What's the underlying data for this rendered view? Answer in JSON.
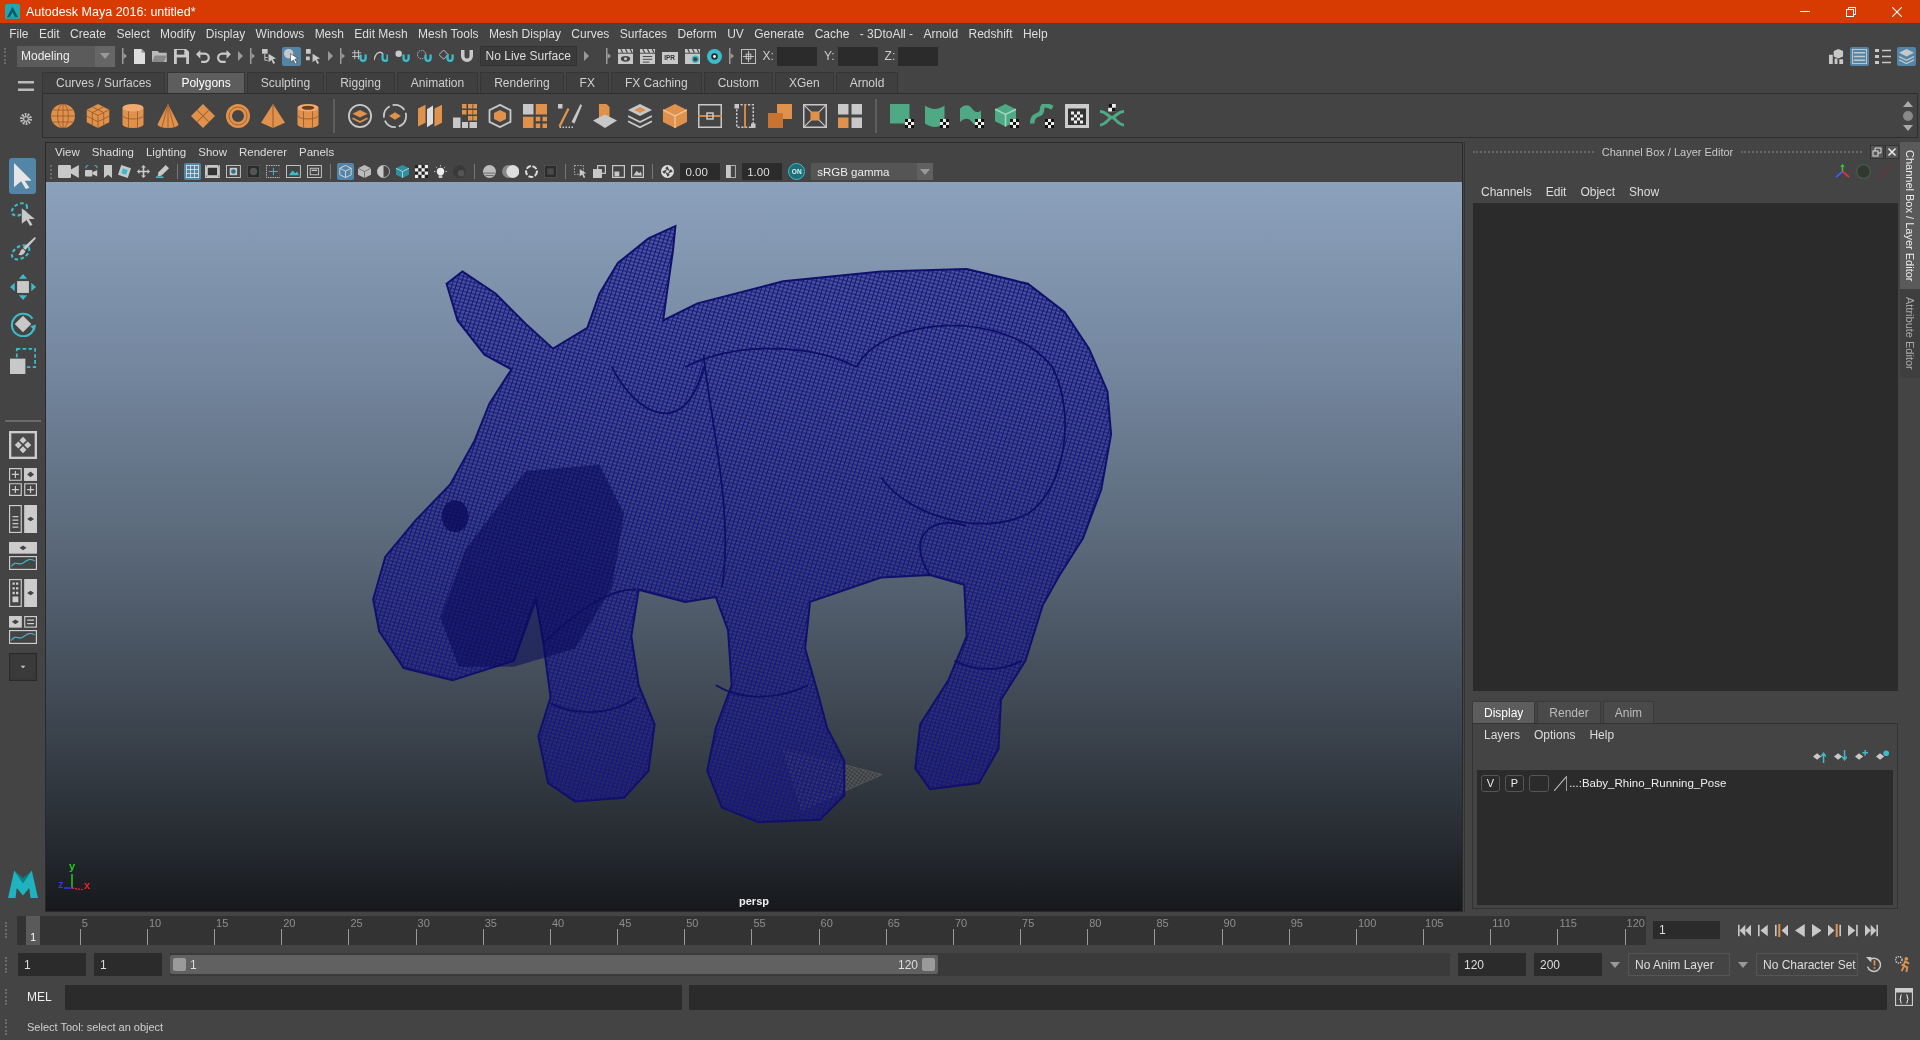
{
  "window": {
    "title": "Autodesk Maya 2016: untitled*"
  },
  "menu_bar": [
    "File",
    "Edit",
    "Create",
    "Select",
    "Modify",
    "Display",
    "Windows",
    "Mesh",
    "Edit Mesh",
    "Mesh Tools",
    "Mesh Display",
    "Curves",
    "Surfaces",
    "Deform",
    "UV",
    "Generate",
    "Cache",
    "- 3DtoAll -",
    "Arnold",
    "Redshift",
    "Help"
  ],
  "status_line": {
    "menu_set": "Modeling",
    "selection_modes": [
      {
        "selected": false
      },
      {
        "selected": true
      },
      {
        "selected": false
      }
    ],
    "live_surface": "No Live Surface",
    "ipr_label": "IPR",
    "coordinate_labels": [
      "X:",
      "Y:",
      "Z:"
    ],
    "panel_toggles": [
      {
        "on": false
      },
      {
        "on": true
      },
      {
        "on": false
      },
      {
        "on": true
      }
    ]
  },
  "shelf": {
    "tabs": [
      {
        "label": "Curves / Surfaces",
        "selected": false
      },
      {
        "label": "Polygons",
        "selected": true
      },
      {
        "label": "Sculpting",
        "selected": false
      },
      {
        "label": "Rigging",
        "selected": false
      },
      {
        "label": "Animation",
        "selected": false
      },
      {
        "label": "Rendering",
        "selected": false
      },
      {
        "label": "FX",
        "selected": false
      },
      {
        "label": "FX Caching",
        "selected": false
      },
      {
        "label": "Custom",
        "selected": false
      },
      {
        "label": "XGen",
        "selected": false
      },
      {
        "label": "Arnold",
        "selected": false
      }
    ]
  },
  "toolbox": {
    "tools": [
      {
        "selected": true
      },
      {
        "selected": false
      },
      {
        "selected": false
      },
      {
        "selected": false
      },
      {
        "selected": false
      },
      {
        "selected": false
      }
    ]
  },
  "viewport": {
    "menu": [
      "View",
      "Shading",
      "Lighting",
      "Show",
      "Renderer",
      "Panels"
    ],
    "toolbar": [
      {
        "on": false
      },
      {
        "on": false
      },
      {
        "on": false
      },
      {
        "on": false
      },
      {
        "on": false
      },
      {
        "on": false
      },
      {
        "on": true
      },
      {
        "on": false
      },
      {
        "on": false
      },
      {
        "on": false
      },
      {
        "on": false
      },
      {
        "on": false
      },
      {
        "on": false
      },
      {
        "on": true
      },
      {
        "on": false
      },
      {
        "on": false
      },
      {
        "on": false
      },
      {
        "on": false
      },
      {
        "on": false
      },
      {
        "on": false
      },
      {
        "on": false
      },
      {
        "on": false
      },
      {
        "on": false
      },
      {
        "on": false
      },
      {
        "on": false
      },
      {
        "on": false
      },
      {
        "on": false
      },
      {
        "on": false
      }
    ],
    "exposure": "0.00",
    "gamma": "1.00",
    "color_management_label": "ON",
    "color_space": "sRGB gamma",
    "axis_labels": [
      "y",
      "z",
      "x"
    ],
    "camera_name": "persp"
  },
  "channel_box": {
    "title": "Channel Box / Layer Editor",
    "menu": [
      "Channels",
      "Edit",
      "Object",
      "Show"
    ]
  },
  "layer_editor": {
    "tabs": [
      {
        "label": "Display",
        "selected": true
      },
      {
        "label": "Render",
        "selected": false
      },
      {
        "label": "Anim",
        "selected": false
      }
    ],
    "menu": [
      "Layers",
      "Options",
      "Help"
    ],
    "layers": [
      {
        "visibility": "V",
        "playback": "P",
        "name": "...:Baby_Rhino_Running_Pose"
      }
    ]
  },
  "side_tabs": [
    {
      "label": "Channel Box / Layer Editor",
      "selected": true
    },
    {
      "label": "Attribute Editor",
      "selected": false
    }
  ],
  "time_slider": {
    "frame_labels": [
      "5",
      "10",
      "15",
      "20",
      "25",
      "30",
      "35",
      "40",
      "45",
      "50",
      "55",
      "60",
      "65",
      "70",
      "75",
      "80",
      "85",
      "90",
      "95",
      "100",
      "105",
      "110",
      "115",
      "120"
    ],
    "current_frame": "1",
    "level": 0.01,
    "current_frame_field": "1"
  },
  "range_slider": {
    "start_frame": "1",
    "playback_start": "1",
    "range_start_label": "1",
    "range_end_label": "120",
    "level": 0.6,
    "playback_end": "120",
    "end_frame": "200",
    "anim_layer": "No Anim Layer",
    "character_set": "No Character Set"
  },
  "command_line": {
    "language": "MEL"
  },
  "help_line": "Select Tool: select an object"
}
